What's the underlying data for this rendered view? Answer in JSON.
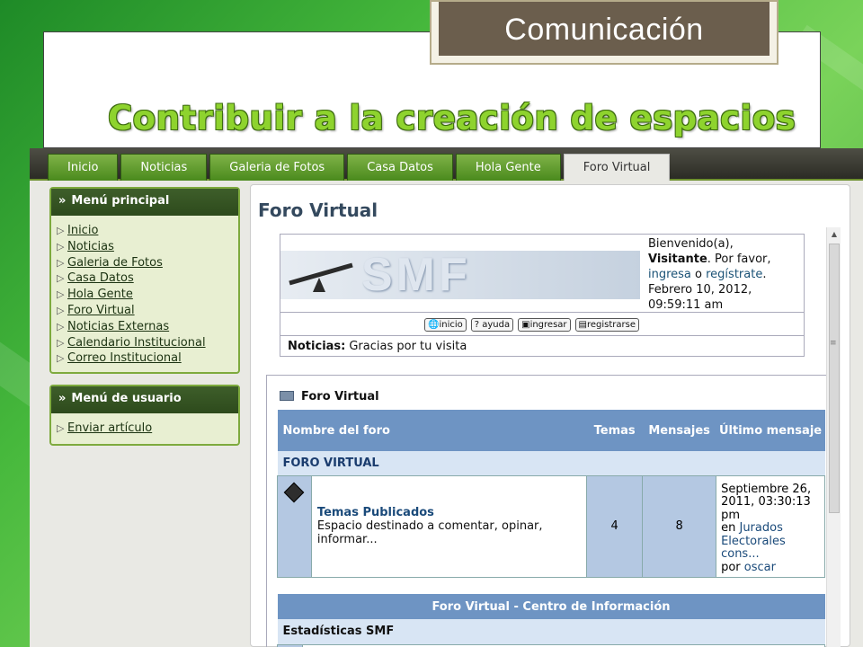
{
  "slide": {
    "comm_label": "Comunicación",
    "heading": "Contribuir a la creación de espacios"
  },
  "browser": {
    "nav_tabs": [
      {
        "label": "Inicio",
        "active": false
      },
      {
        "label": "Noticias",
        "active": false
      },
      {
        "label": "Galeria de Fotos",
        "active": false
      },
      {
        "label": "Casa Datos",
        "active": false
      },
      {
        "label": "Hola Gente",
        "active": false
      },
      {
        "label": "Foro Virtual",
        "active": true
      }
    ],
    "main_menu": {
      "title": "Menú principal",
      "items": [
        "Inicio",
        "Noticias",
        "Galeria de Fotos",
        "Casa Datos",
        "Hola Gente",
        "Foro Virtual",
        "Noticias Externas",
        "Calendario Institucional",
        "Correo Institucional"
      ]
    },
    "user_menu": {
      "title": "Menú de usuario",
      "items": [
        "Enviar artículo"
      ]
    },
    "page_title": "Foro Virtual",
    "smf": {
      "logo_text": "SMF",
      "welcome_line1": "Bienvenido(a),",
      "visitor": "Visitante",
      "welcome_line2": ". Por favor,",
      "login": "ingresa",
      "or": " o ",
      "register": "regístrate",
      "dot": ".",
      "date": "Febrero 10, 2012,",
      "time": "09:59:11 am",
      "buttons": [
        "inicio",
        "ayuda",
        "ingresar",
        "registrarse"
      ],
      "news_label": "Noticias:",
      "news_text": "Gracias por tu visita"
    },
    "forum": {
      "caption": "Foro Virtual",
      "headers": {
        "name": "Nombre del foro",
        "topics": "Temas",
        "posts": "Mensajes",
        "last": "Último mensaje"
      },
      "category": "FORO VIRTUAL",
      "board": {
        "name": "Temas Publicados",
        "description": "Espacio destinado a comentar, opinar, informar...",
        "topics": "4",
        "posts": "8",
        "last_date": "Septiembre 26, 2011, 03:30:13 pm",
        "last_in": "en",
        "last_board": "Jurados Electorales cons...",
        "last_by": "por",
        "last_user": "oscar"
      },
      "stats_title": "Foro Virtual - Centro de Información",
      "stats_sub": "Estadísticas SMF"
    }
  }
}
